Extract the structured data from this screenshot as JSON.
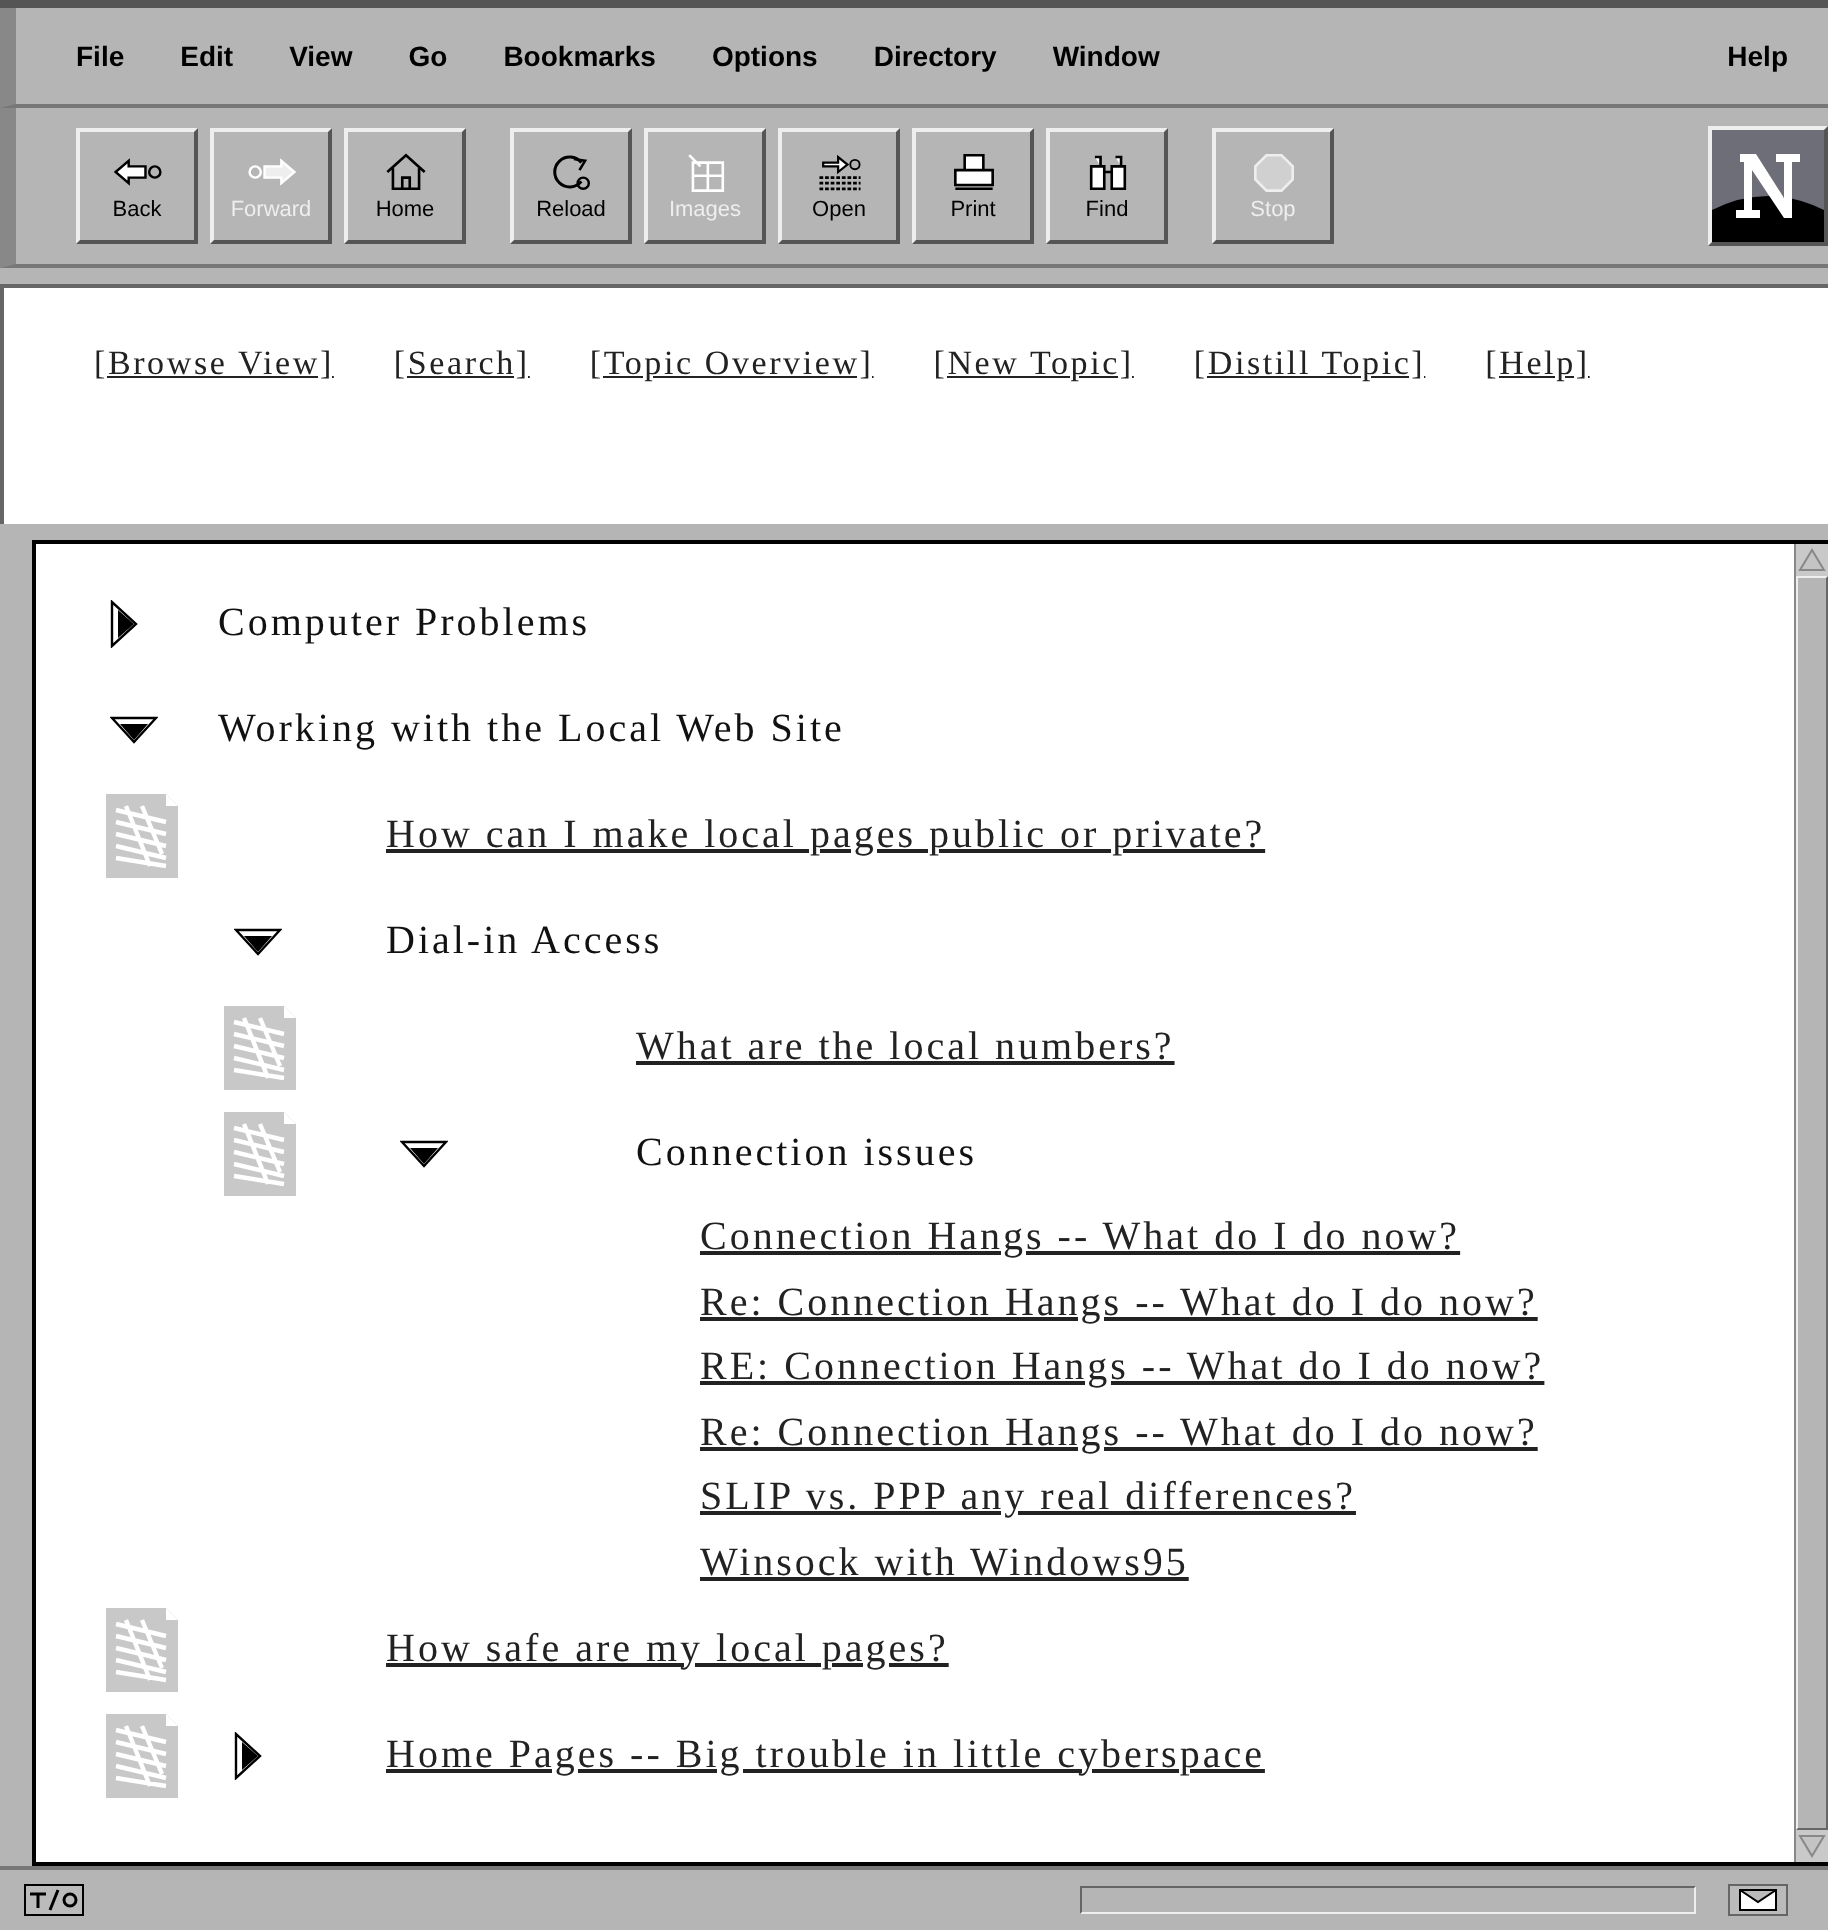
{
  "menu": {
    "items": [
      "File",
      "Edit",
      "View",
      "Go",
      "Bookmarks",
      "Options",
      "Directory",
      "Window"
    ],
    "help": "Help"
  },
  "toolbar": [
    [
      {
        "label": "Back",
        "disabled": false
      },
      {
        "label": "Forward",
        "disabled": true
      },
      {
        "label": "Home",
        "disabled": false
      }
    ],
    [
      {
        "label": "Reload",
        "disabled": false
      },
      {
        "label": "Images",
        "disabled": true
      },
      {
        "label": "Open",
        "disabled": false
      },
      {
        "label": "Print",
        "disabled": false
      },
      {
        "label": "Find",
        "disabled": false
      }
    ],
    [
      {
        "label": "Stop",
        "disabled": true
      }
    ]
  ],
  "nav_links": [
    "[Browse View]",
    "[Search]",
    "[Topic Overview]",
    "[New Topic]",
    "[Distill Topic]",
    "[Help]"
  ],
  "tree": [
    {
      "kind": "topic",
      "label": "Computer Problems",
      "expanded": false,
      "document": false,
      "link": false
    },
    {
      "kind": "topic",
      "label": "Working with the Local Web Site",
      "expanded": true,
      "document": false,
      "link": false,
      "children": [
        {
          "kind": "doc",
          "label": "How can I make local pages public or private?",
          "link": true
        },
        {
          "kind": "topic",
          "label": "Dial-in Access",
          "expanded": true,
          "document": false,
          "link": false,
          "children": [
            {
              "kind": "doc",
              "label": "What are the local numbers?",
              "link": true
            },
            {
              "kind": "topic",
              "label": "Connection issues",
              "expanded": true,
              "document": true,
              "link": false,
              "children": [
                {
                  "kind": "message",
                  "label": "Connection Hangs -- What do I do now?",
                  "link": true
                },
                {
                  "kind": "message",
                  "label": "Re: Connection Hangs -- What do I do now?",
                  "link": true
                },
                {
                  "kind": "message",
                  "label": "RE: Connection Hangs -- What do I do now?",
                  "link": true
                },
                {
                  "kind": "message",
                  "label": "Re: Connection Hangs -- What do I do now?",
                  "link": true
                },
                {
                  "kind": "message",
                  "label": "SLIP vs. PPP any real differences?",
                  "link": true
                },
                {
                  "kind": "message",
                  "label": "Winsock with Windows95",
                  "link": true
                }
              ]
            }
          ]
        },
        {
          "kind": "doc",
          "label": "How safe are my local pages?",
          "link": true
        },
        {
          "kind": "topic",
          "label": "Home Pages -- Big trouble in little cyberspace",
          "expanded": false,
          "document": true,
          "link": true
        }
      ]
    }
  ]
}
